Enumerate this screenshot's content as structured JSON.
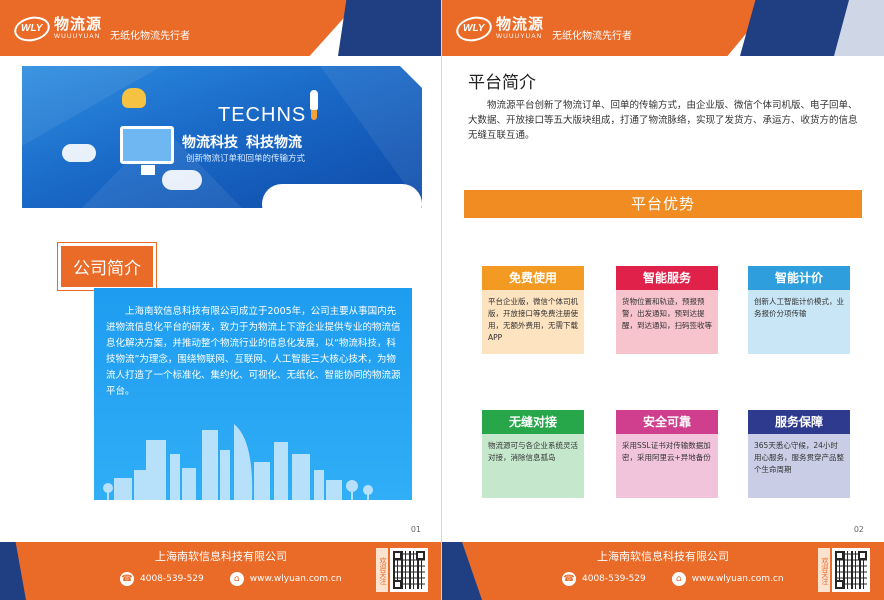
{
  "brand": {
    "logo_mark": "WLY",
    "logo_cn": "物流源",
    "logo_en": "WUUUYUAN",
    "slogan": "无纸化物流先行者"
  },
  "footer": {
    "company": "上海南软信息科技有限公司",
    "phone": "4008-539-529",
    "website": "www.wlyuan.com.cn",
    "follow": "欢迎关注"
  },
  "left_page": {
    "banner": {
      "techns": "TECHNS",
      "slogan_a": "物流科技",
      "slogan_b": "科技物流",
      "sub": "创新物流订单和回单的传输方式"
    },
    "section_title": "公司简介",
    "intro": "上海南软信息科技有限公司成立于2005年，公司主要从事国内先进物流信息化平台的研发，致力于为物流上下游企业提供专业的物流信息化解决方案，并推动整个物流行业的信息化发展，以“物流科技，科技物流”为理念，围绕物联网、互联网、人工智能三大核心技术，为物流人打造了一个标准化、集约化、可视化、无纸化、智能协同的物流源平台。",
    "page_number": "01"
  },
  "right_page": {
    "title": "平台简介",
    "intro": "物流源平台创新了物流订单、回单的传输方式，由企业版、微信个体司机版、电子回单、大数据、开放接口等五大版块组成，打通了物流脉络，实现了发货方、承运方、收货方的信息无缝互联互通。",
    "advantages_title": "平台优势",
    "cards": [
      {
        "title": "免费使用",
        "body": "平台企业版，微信个体司机版，开放接口等免费注册使用，无额外费用，无需下载APP",
        "color": "#f39a22"
      },
      {
        "title": "智能服务",
        "body": "货物位置和轨迹，预报预警，出发通知，预到达提醒，到达通知，扫码签收等",
        "color": "#e0224a"
      },
      {
        "title": "智能计价",
        "body": "创新人工智能计价模式，业务报价分项传输",
        "color": "#2e9fdc"
      },
      {
        "title": "无缝对接",
        "body": "物流源可与各企业系统灵活对接，消除信息孤岛",
        "color": "#27a64a"
      },
      {
        "title": "安全可靠",
        "body": "采用SSL证书对传输数据加密，采用阿里云+异地备份",
        "color": "#cf3f8e"
      },
      {
        "title": "服务保障",
        "body": "365天悉心守候，24小时用心服务，服务贯穿产品整个生命周期",
        "color": "#2d3a8e"
      }
    ],
    "page_number": "02"
  },
  "icons": {
    "phone": "phone-icon",
    "home": "home-icon",
    "qr": "qr-code-icon"
  }
}
